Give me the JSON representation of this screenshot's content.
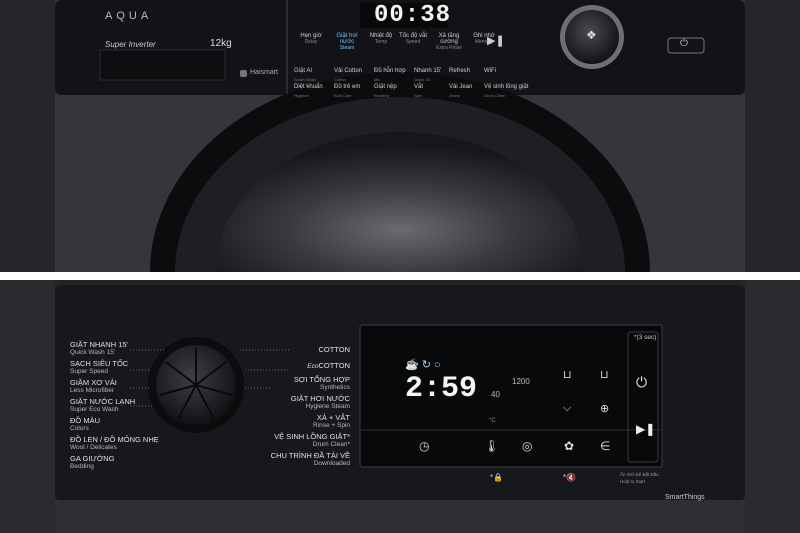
{
  "top_panel": {
    "brand": "AQUA",
    "series": "Super Inverter",
    "capacity": "12kg",
    "app_logo": "Haismart",
    "display_time": "00:38",
    "option_buttons": [
      {
        "vi": "Hẹn giờ",
        "en": "Delay"
      },
      {
        "vi": "Giặt hơi nước",
        "en": "Steam"
      },
      {
        "vi": "Nhiệt độ",
        "en": "Temp"
      },
      {
        "vi": "Tốc độ vắt",
        "en": "Speed"
      },
      {
        "vi": "Xả tăng cường",
        "en": "Extra Rinse"
      },
      {
        "vi": "Ghi nhớ",
        "en": "Memory"
      }
    ],
    "programs_row1": [
      {
        "vi": "Giặt AI",
        "en": "Smart Wash"
      },
      {
        "vi": "Vải Cotton",
        "en": "Cotton"
      },
      {
        "vi": "Đồ hỗn hợp",
        "en": "Mix"
      },
      {
        "vi": "Nhanh 15'",
        "en": "Quick 15'"
      },
      {
        "vi": "Refresh",
        "en": ""
      },
      {
        "vi": "WiFi",
        "en": ""
      }
    ],
    "programs_row2": [
      {
        "vi": "Diệt khuẩn",
        "en": "Hygiene"
      },
      {
        "vi": "Đồ trẻ em",
        "en": "Kids Care"
      },
      {
        "vi": "Giặt nệp",
        "en": "Bedding"
      },
      {
        "vi": "Vắt",
        "en": "Spin"
      },
      {
        "vi": "Vải Jean",
        "en": "Jeans"
      },
      {
        "vi": "Vệ sinh lồng giặt",
        "en": "Drum Clean"
      }
    ],
    "power_icon": "power-icon"
  },
  "bottom_panel": {
    "left_programs": [
      {
        "vi": "GIẶT NHANH 15'",
        "en": "Quick Wash 15'"
      },
      {
        "vi": "SẠCH SIÊU TỐC",
        "en": "Super Speed"
      },
      {
        "vi": "GIẶM XƠ VẢI",
        "en": "Less Microfiber"
      },
      {
        "vi": "GIẶT NƯỚC LẠNH",
        "en": "Super Eco Wash"
      },
      {
        "vi": "ĐỒ MÀU",
        "en": "Colors"
      },
      {
        "vi": "ĐỒ LEN / ĐỒ MỎNG NHẸ",
        "en": "Wool / Delicates"
      },
      {
        "vi": "GA GIƯỜNG",
        "en": "Bedding"
      }
    ],
    "right_programs": [
      {
        "vi": "COTTON",
        "en": ""
      },
      {
        "vi": "COTTON",
        "en": "",
        "prefix": "Eco"
      },
      {
        "vi": "SỢI TỔNG HỢP",
        "en": "Synthetics"
      },
      {
        "vi": "GIẶT HƠI NƯỚC",
        "en": "Hygiene Steam"
      },
      {
        "vi": "XẢ + VẮT",
        "en": "Rinse + Spin"
      },
      {
        "vi": "VỆ SINH LỒNG GIẶT*",
        "en": "Drum Clean*"
      },
      {
        "vi": "CHU TRÌNH ĐÃ TẢI VỀ",
        "en": "Downloaded"
      }
    ],
    "display_time": "2:59",
    "display_spin": "1200",
    "display_temp": "40",
    "temp_unit": "°C",
    "hold_note": "*(3 sec)",
    "start_note_vi": "Ấn Giữ Để Bắt Đầu",
    "start_note_en": "Hold to Start",
    "smartthings": "SmartThings",
    "lock_label": "*",
    "mute_label": "*"
  }
}
